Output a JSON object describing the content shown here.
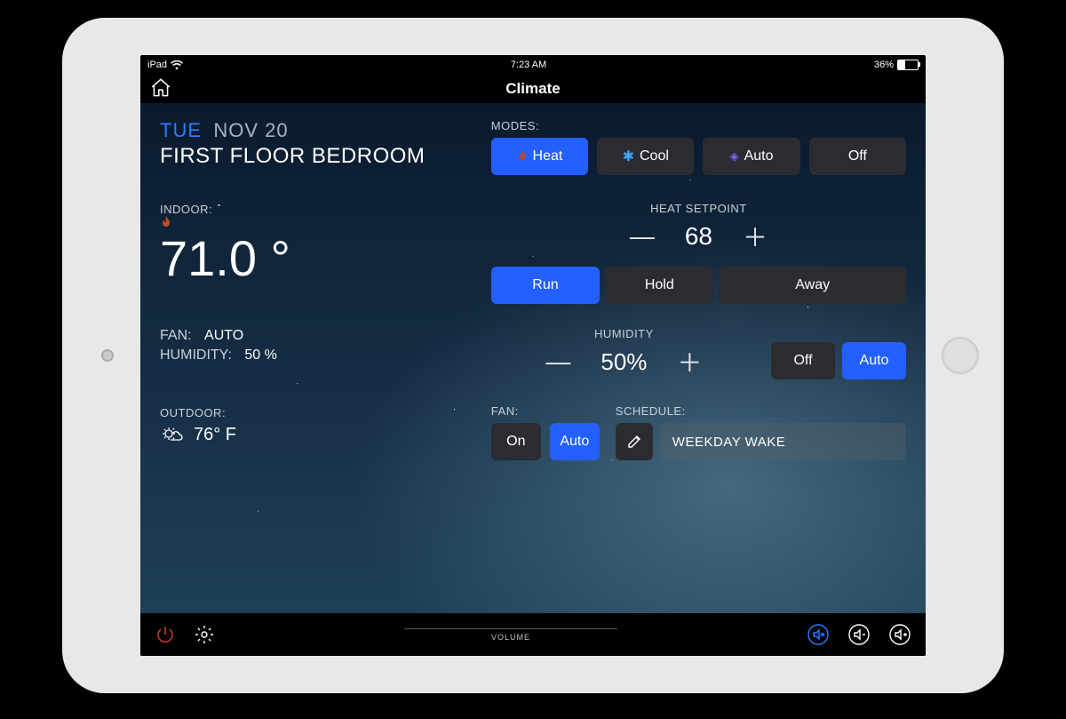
{
  "status": {
    "device": "iPad",
    "time": "7:23 AM",
    "battery_pct": "36%"
  },
  "header": {
    "title": "Climate"
  },
  "date": {
    "day": "TUE",
    "date": "NOV 20"
  },
  "room": "FIRST FLOOR BEDROOM",
  "indoor": {
    "label": "INDOOR:",
    "temp": "71.0 °",
    "fan_label": "FAN:",
    "fan_value": "AUTO",
    "humidity_label": "HUMIDITY:",
    "humidity_value": "50 %"
  },
  "outdoor": {
    "label": "OUTDOOR:",
    "temp": "76° F"
  },
  "modes": {
    "label": "MODES:",
    "heat": "Heat",
    "cool": "Cool",
    "auto": "Auto",
    "off": "Off"
  },
  "setpoint": {
    "label": "HEAT SETPOINT",
    "value": "68"
  },
  "runmode": {
    "run": "Run",
    "hold": "Hold",
    "away": "Away"
  },
  "humidity": {
    "label": "HUMIDITY",
    "value": "50%",
    "off": "Off",
    "auto": "Auto"
  },
  "fan": {
    "label": "FAN:",
    "on": "On",
    "auto": "Auto"
  },
  "schedule": {
    "label": "SCHEDULE:",
    "name": "WEEKDAY WAKE"
  },
  "footer": {
    "volume_label": "VOLUME"
  }
}
